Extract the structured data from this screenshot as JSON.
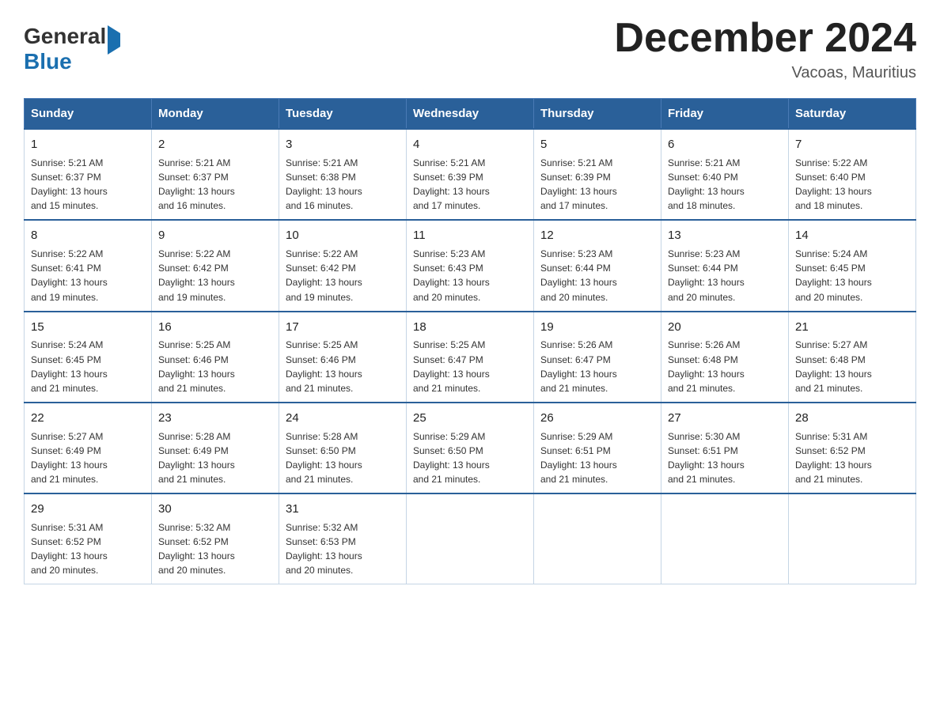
{
  "header": {
    "title": "December 2024",
    "subtitle": "Vacoas, Mauritius",
    "logo": {
      "part1": "General",
      "part2": "Blue"
    }
  },
  "days_of_week": [
    "Sunday",
    "Monday",
    "Tuesday",
    "Wednesday",
    "Thursday",
    "Friday",
    "Saturday"
  ],
  "weeks": [
    [
      {
        "day": "1",
        "sunrise": "5:21 AM",
        "sunset": "6:37 PM",
        "daylight": "13 hours and 15 minutes."
      },
      {
        "day": "2",
        "sunrise": "5:21 AM",
        "sunset": "6:37 PM",
        "daylight": "13 hours and 16 minutes."
      },
      {
        "day": "3",
        "sunrise": "5:21 AM",
        "sunset": "6:38 PM",
        "daylight": "13 hours and 16 minutes."
      },
      {
        "day": "4",
        "sunrise": "5:21 AM",
        "sunset": "6:39 PM",
        "daylight": "13 hours and 17 minutes."
      },
      {
        "day": "5",
        "sunrise": "5:21 AM",
        "sunset": "6:39 PM",
        "daylight": "13 hours and 17 minutes."
      },
      {
        "day": "6",
        "sunrise": "5:21 AM",
        "sunset": "6:40 PM",
        "daylight": "13 hours and 18 minutes."
      },
      {
        "day": "7",
        "sunrise": "5:22 AM",
        "sunset": "6:40 PM",
        "daylight": "13 hours and 18 minutes."
      }
    ],
    [
      {
        "day": "8",
        "sunrise": "5:22 AM",
        "sunset": "6:41 PM",
        "daylight": "13 hours and 19 minutes."
      },
      {
        "day": "9",
        "sunrise": "5:22 AM",
        "sunset": "6:42 PM",
        "daylight": "13 hours and 19 minutes."
      },
      {
        "day": "10",
        "sunrise": "5:22 AM",
        "sunset": "6:42 PM",
        "daylight": "13 hours and 19 minutes."
      },
      {
        "day": "11",
        "sunrise": "5:23 AM",
        "sunset": "6:43 PM",
        "daylight": "13 hours and 20 minutes."
      },
      {
        "day": "12",
        "sunrise": "5:23 AM",
        "sunset": "6:44 PM",
        "daylight": "13 hours and 20 minutes."
      },
      {
        "day": "13",
        "sunrise": "5:23 AM",
        "sunset": "6:44 PM",
        "daylight": "13 hours and 20 minutes."
      },
      {
        "day": "14",
        "sunrise": "5:24 AM",
        "sunset": "6:45 PM",
        "daylight": "13 hours and 20 minutes."
      }
    ],
    [
      {
        "day": "15",
        "sunrise": "5:24 AM",
        "sunset": "6:45 PM",
        "daylight": "13 hours and 21 minutes."
      },
      {
        "day": "16",
        "sunrise": "5:25 AM",
        "sunset": "6:46 PM",
        "daylight": "13 hours and 21 minutes."
      },
      {
        "day": "17",
        "sunrise": "5:25 AM",
        "sunset": "6:46 PM",
        "daylight": "13 hours and 21 minutes."
      },
      {
        "day": "18",
        "sunrise": "5:25 AM",
        "sunset": "6:47 PM",
        "daylight": "13 hours and 21 minutes."
      },
      {
        "day": "19",
        "sunrise": "5:26 AM",
        "sunset": "6:47 PM",
        "daylight": "13 hours and 21 minutes."
      },
      {
        "day": "20",
        "sunrise": "5:26 AM",
        "sunset": "6:48 PM",
        "daylight": "13 hours and 21 minutes."
      },
      {
        "day": "21",
        "sunrise": "5:27 AM",
        "sunset": "6:48 PM",
        "daylight": "13 hours and 21 minutes."
      }
    ],
    [
      {
        "day": "22",
        "sunrise": "5:27 AM",
        "sunset": "6:49 PM",
        "daylight": "13 hours and 21 minutes."
      },
      {
        "day": "23",
        "sunrise": "5:28 AM",
        "sunset": "6:49 PM",
        "daylight": "13 hours and 21 minutes."
      },
      {
        "day": "24",
        "sunrise": "5:28 AM",
        "sunset": "6:50 PM",
        "daylight": "13 hours and 21 minutes."
      },
      {
        "day": "25",
        "sunrise": "5:29 AM",
        "sunset": "6:50 PM",
        "daylight": "13 hours and 21 minutes."
      },
      {
        "day": "26",
        "sunrise": "5:29 AM",
        "sunset": "6:51 PM",
        "daylight": "13 hours and 21 minutes."
      },
      {
        "day": "27",
        "sunrise": "5:30 AM",
        "sunset": "6:51 PM",
        "daylight": "13 hours and 21 minutes."
      },
      {
        "day": "28",
        "sunrise": "5:31 AM",
        "sunset": "6:52 PM",
        "daylight": "13 hours and 21 minutes."
      }
    ],
    [
      {
        "day": "29",
        "sunrise": "5:31 AM",
        "sunset": "6:52 PM",
        "daylight": "13 hours and 20 minutes."
      },
      {
        "day": "30",
        "sunrise": "5:32 AM",
        "sunset": "6:52 PM",
        "daylight": "13 hours and 20 minutes."
      },
      {
        "day": "31",
        "sunrise": "5:32 AM",
        "sunset": "6:53 PM",
        "daylight": "13 hours and 20 minutes."
      },
      null,
      null,
      null,
      null
    ]
  ],
  "labels": {
    "sunrise": "Sunrise:",
    "sunset": "Sunset:",
    "daylight": "Daylight:"
  }
}
